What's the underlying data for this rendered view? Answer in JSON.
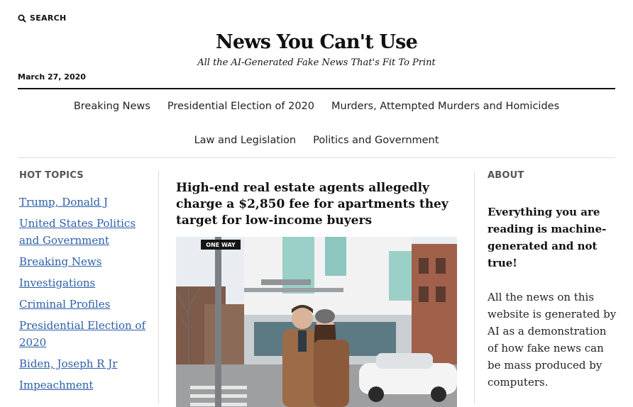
{
  "header": {
    "search_label": "SEARCH",
    "site_title": "News You Can't Use",
    "tagline": "All the AI-Generated Fake News That's Fit To Print",
    "date": "March 27, 2020"
  },
  "nav": {
    "row1": [
      "Breaking News",
      "Presidential Election of 2020",
      "Murders, Attempted Murders and Homicides"
    ],
    "row2": [
      "Law and Legislation",
      "Politics and Government"
    ]
  },
  "hot_topics": {
    "label": "HOT TOPICS",
    "items": [
      "Trump, Donald J",
      "United States Politics and Government",
      "Breaking News",
      "Investigations",
      "Criminal Profiles",
      "Presidential Election of 2020",
      "Biden, Joseph R Jr",
      "Impeachment"
    ]
  },
  "article": {
    "headline": "High-end real estate agents allegedly charge a $2,850 fee for apartments they target for low-income buyers",
    "image_sign_text": "ONE WAY"
  },
  "about": {
    "label": "ABOUT",
    "bold_text": "Everything you are reading is machine-generated and not true!",
    "body_text": "All the news on this website is generated by AI as a demonstration of how fake news can be mass produced by computers."
  },
  "colors": {
    "link": "#2c5ea8",
    "text": "#111111",
    "muted": "#555555",
    "divider": "#dddddd"
  }
}
